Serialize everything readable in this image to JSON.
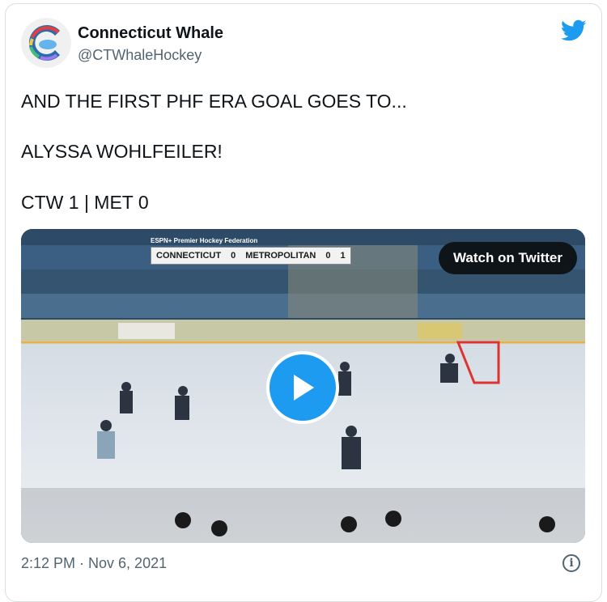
{
  "tweet": {
    "author_name": "Connecticut Whale",
    "author_handle": "@CTWhaleHockey",
    "text_line1": "AND THE FIRST PHF ERA GOAL GOES TO...",
    "text_line2": "ALYSSA WOHLFEILER!",
    "text_line3": "CTW 1 | MET 0",
    "timestamp": "2:12 PM · Nov 6, 2021"
  },
  "media": {
    "watch_label": "Watch on Twitter",
    "broadcast": "ESPN+ Premier Hockey Federation",
    "team_home": "CONNECTICUT",
    "score_home": "0",
    "team_away": "METROPOLITAN",
    "score_away": "0",
    "period_fragment": "1"
  },
  "icons": {
    "brand": "twitter-bird-icon",
    "play": "play-icon",
    "info": "info-icon"
  },
  "colors": {
    "twitter_blue": "#1d9bf0",
    "secondary_text": "#536471",
    "watch_button_bg": "#0f1419"
  }
}
